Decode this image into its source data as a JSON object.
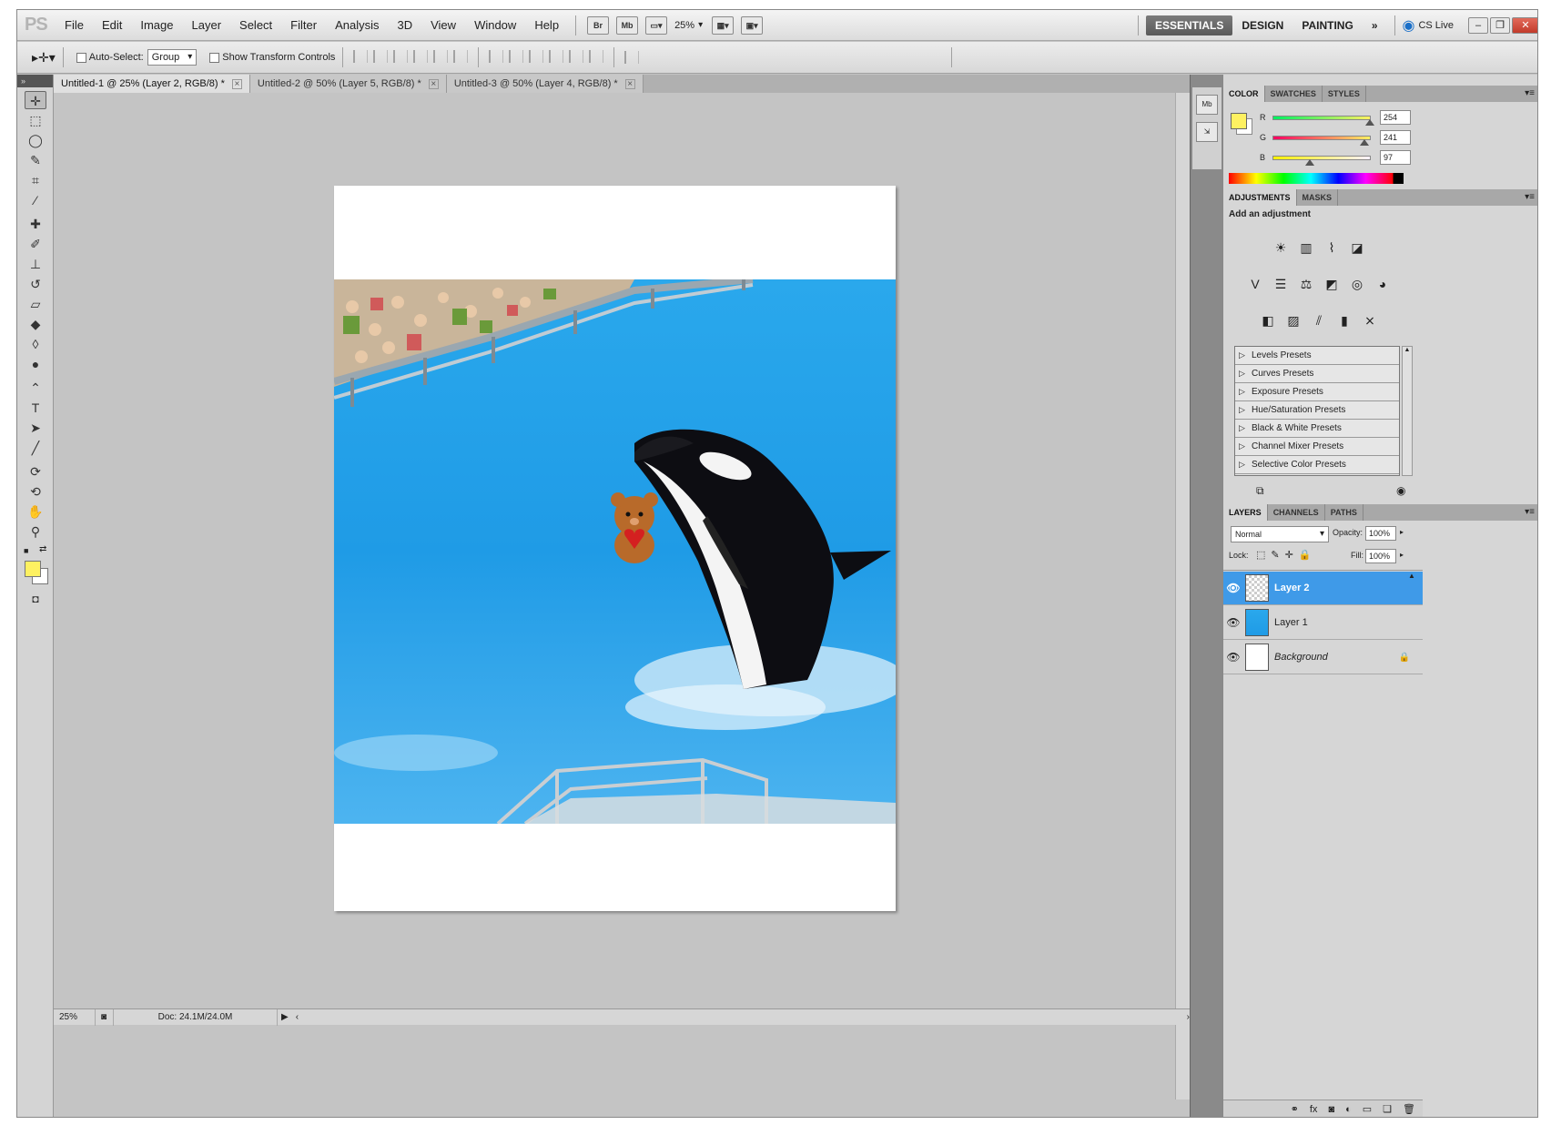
{
  "app": {
    "logo": "PS"
  },
  "menu": [
    "File",
    "Edit",
    "Image",
    "Layer",
    "Select",
    "Filter",
    "Analysis",
    "3D",
    "View",
    "Window",
    "Help"
  ],
  "appbar": {
    "bridge": "Br",
    "minibridge": "Mb",
    "zoom": "25%"
  },
  "workspaces": {
    "essentials": "ESSENTIALS",
    "design": "DESIGN",
    "painting": "PAINTING",
    "more": "»",
    "cslive": "CS Live"
  },
  "options": {
    "auto_select_label": "Auto-Select:",
    "auto_select_value": "Group",
    "show_transform_label": "Show Transform Controls"
  },
  "tabs": [
    {
      "label": "Untitled-1 @ 25% (Layer 2, RGB/8) *",
      "active": true
    },
    {
      "label": "Untitled-2 @ 50% (Layer 5, RGB/8) *",
      "active": false
    },
    {
      "label": "Untitled-3 @ 50% (Layer 4, RGB/8) *",
      "active": false
    }
  ],
  "colors": {
    "foreground": "#fef161",
    "background": "#ffffff",
    "accent": "#3f9ae8"
  },
  "status": {
    "zoom": "25%",
    "doc": "Doc: 24.1M/24.0M"
  },
  "color_panel": {
    "tabs": [
      "COLOR",
      "SWATCHES",
      "STYLES"
    ],
    "r": {
      "label": "R",
      "value": "254"
    },
    "g": {
      "label": "G",
      "value": "241"
    },
    "b": {
      "label": "B",
      "value": "97"
    }
  },
  "adjustments": {
    "tabs": [
      "ADJUSTMENTS",
      "MASKS"
    ],
    "title": "Add an adjustment",
    "presets": [
      "Levels Presets",
      "Curves Presets",
      "Exposure Presets",
      "Hue/Saturation Presets",
      "Black & White Presets",
      "Channel Mixer Presets",
      "Selective Color Presets"
    ]
  },
  "layers_panel": {
    "tabs": [
      "LAYERS",
      "CHANNELS",
      "PATHS"
    ],
    "blend_mode": "Normal",
    "opacity_label": "Opacity:",
    "opacity": "100%",
    "lock_label": "Lock:",
    "fill_label": "Fill:",
    "fill": "100%",
    "layers": [
      {
        "name": "Layer 2",
        "active": true
      },
      {
        "name": "Layer 1",
        "active": false
      },
      {
        "name": "Background",
        "active": false
      }
    ]
  }
}
